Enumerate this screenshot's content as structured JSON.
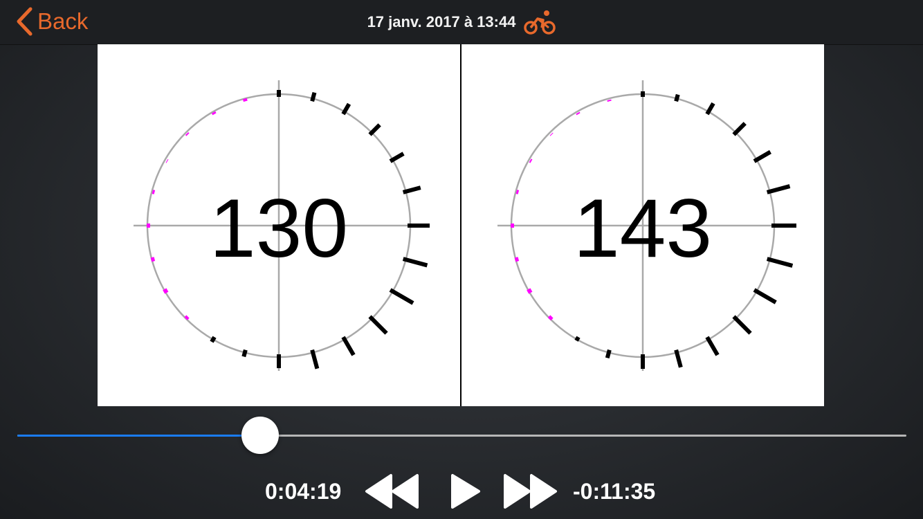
{
  "header": {
    "back_label": "Back",
    "title": "17 janv. 2017 à 13:44",
    "activity_icon": "bicycle-icon",
    "accent_color": "#e8692c"
  },
  "panels": [
    {
      "value": "130"
    },
    {
      "value": "143"
    }
  ],
  "player": {
    "elapsed": "0:04:19",
    "remaining": "-0:11:35",
    "progress_percent": 27.3,
    "progress_color": "#1a7cf5",
    "buttons": {
      "rewind": "rewind-icon",
      "play": "play-icon",
      "forward": "fast-forward-icon"
    }
  },
  "colors": {
    "left_leg": "#ff00ff",
    "right_leg": "#000000",
    "circle": "#a9a9a9"
  }
}
